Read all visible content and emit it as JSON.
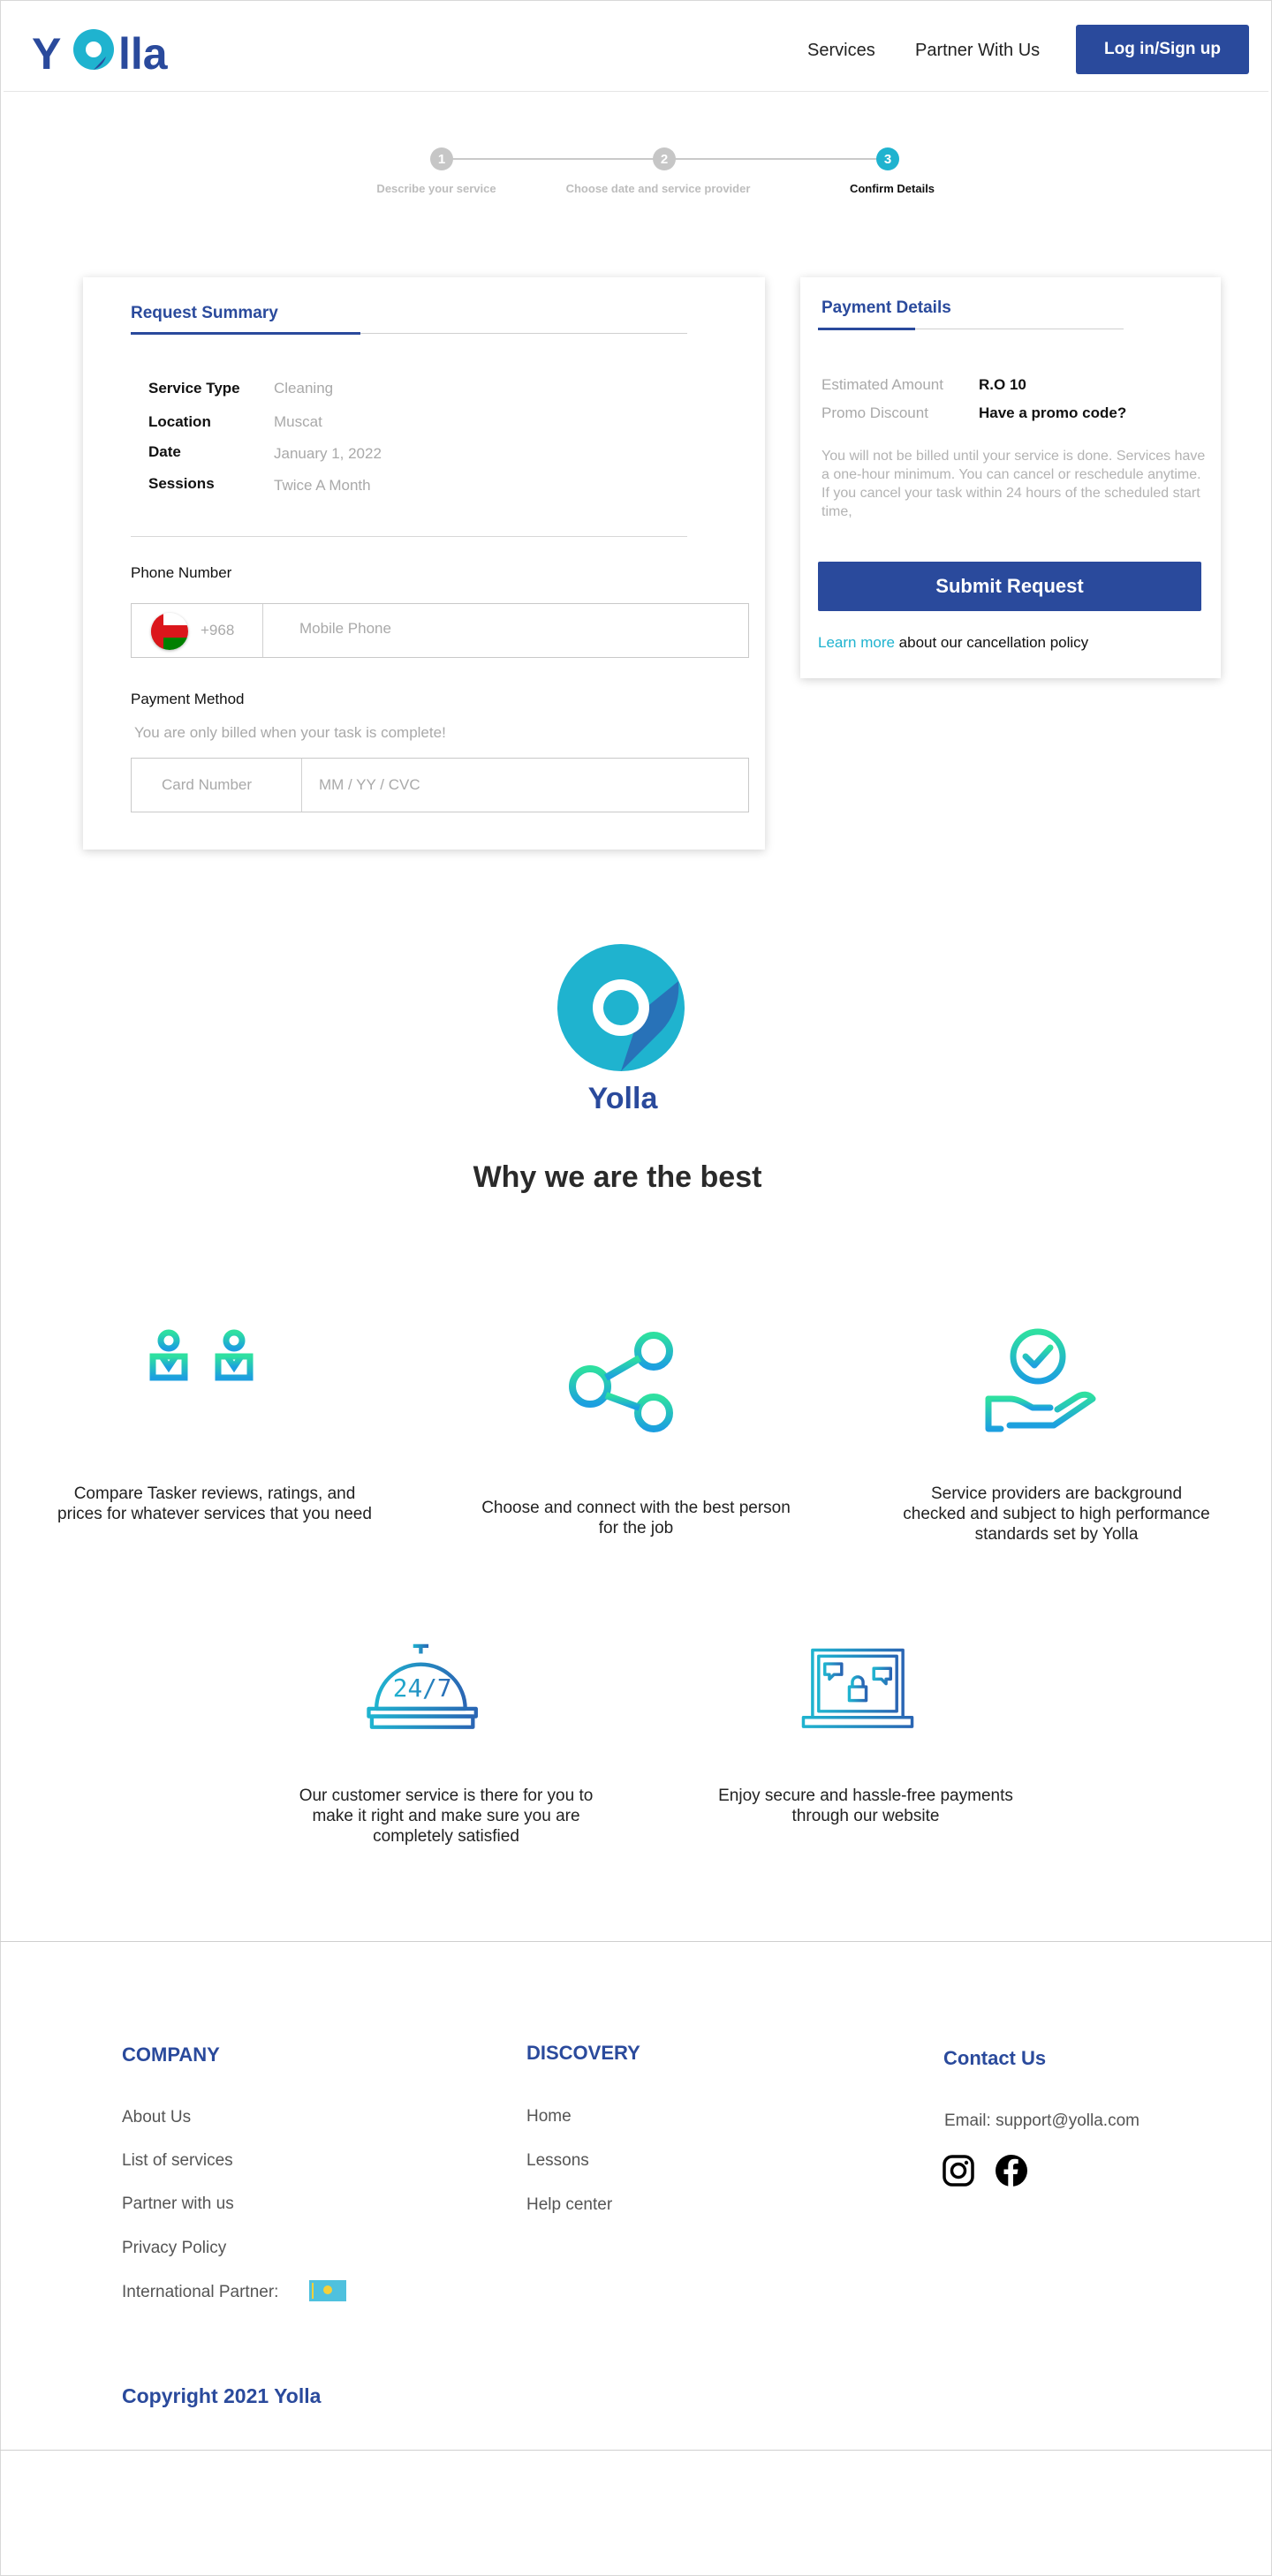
{
  "brand": {
    "name": "Yolla"
  },
  "nav": {
    "services": "Services",
    "partner": "Partner With Us",
    "login": "Log in/Sign up"
  },
  "stepper": {
    "steps": [
      {
        "num": "1",
        "label": "Describe your service"
      },
      {
        "num": "2",
        "label": "Choose date and service provider"
      },
      {
        "num": "3",
        "label": "Confirm Details"
      }
    ],
    "active": 3
  },
  "request_summary": {
    "title": "Request Summary",
    "rows": [
      {
        "label": "Service Type",
        "value": "Cleaning"
      },
      {
        "label": "Location",
        "value": "Muscat"
      },
      {
        "label": "Date",
        "value": "January 1, 2022"
      },
      {
        "label": "Sessions",
        "value": "Twice A Month"
      }
    ],
    "phone_label": "Phone Number",
    "dial_code": "+968",
    "phone_placeholder": "Mobile Phone",
    "payment_method_label": "Payment Method",
    "billed_note": "You are only billed when your task is complete!",
    "card_placeholder": "Card Number",
    "expiry_placeholder": "MM / YY / CVC"
  },
  "payment_details": {
    "title": "Payment Details",
    "estimated_label": "Estimated Amount",
    "estimated_value": "R.O 10",
    "promo_label": "Promo Discount",
    "promo_value": "Have a promo code?",
    "note": "You will not be billed until your service is done. Services have a one-hour minimum. You can cancel or reschedule anytime. If you cancel your task within 24 hours of the scheduled start time,",
    "submit": "Submit Request",
    "learn_more": "Learn more",
    "policy_text": " about our cancellation policy"
  },
  "why": {
    "title": "Why we are the best",
    "features": [
      {
        "icon": "compare-icon",
        "text": "Compare Tasker reviews, ratings, and prices for whatever services that you need"
      },
      {
        "icon": "share-icon",
        "text": "Choose and connect with the best person for the job"
      },
      {
        "icon": "verified-hand-icon",
        "text": "Service providers are background checked and subject to high performance standards set by Yolla"
      },
      {
        "icon": "support-24-7-icon",
        "text": "Our customer service is there for you to make it right and make sure you are completely satisfied"
      },
      {
        "icon": "secure-laptop-icon",
        "text": "Enjoy secure and hassle-free payments through our website"
      }
    ]
  },
  "footer": {
    "company": {
      "title": "COMPANY",
      "links": [
        "About Us",
        "List of services",
        "Partner with us",
        "Privacy Policy",
        "International Partner:"
      ]
    },
    "discovery": {
      "title": "DISCOVERY",
      "links": [
        "Home",
        "Lessons",
        "Help center"
      ]
    },
    "contact": {
      "title": "Contact Us",
      "email": "Email: support@yolla.com"
    },
    "copyright": "Copyright 2021 Yolla"
  },
  "colors": {
    "primary": "#2a4a9c",
    "accent": "#1fb3cf",
    "muted": "#a9a9a9"
  }
}
